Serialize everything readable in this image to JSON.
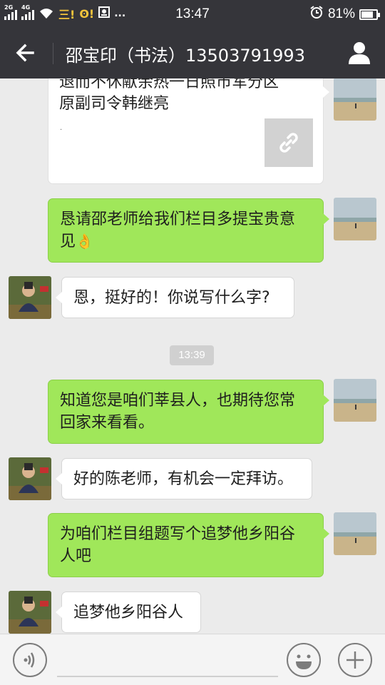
{
  "status_bar": {
    "left": {
      "sim1_label": "2G",
      "sim2_label": "4G",
      "notif_icons": [
        "三!",
        "ʘ!",
        "image-icon",
        "..."
      ]
    },
    "time": "13:47",
    "alarm_icon": "alarm-clock-icon",
    "battery_text": "81%",
    "battery_level": 0.81
  },
  "header": {
    "back_icon": "arrow-left-icon",
    "title": "邵宝印（书法）13503791993",
    "profile_icon": "person-icon"
  },
  "messages": [
    {
      "type": "link_card",
      "from": "me",
      "title_lines": [
        "退而不休献余热一日照市军分区",
        "原副司令韩继亮"
      ],
      "description": "·",
      "thumb_icon": "link-icon"
    },
    {
      "type": "text",
      "from": "me",
      "lines": [
        "恳请邵老师给我们栏目多提宝贵意",
        "见"
      ],
      "emoji": "👌"
    },
    {
      "type": "text",
      "from": "other",
      "text": "恩，挺好的！你说写什么字?"
    },
    {
      "type": "time",
      "text": "13:39"
    },
    {
      "type": "text",
      "from": "me",
      "lines": [
        "知道您是咱们莘县人，也期待您常",
        "回家来看看。"
      ]
    },
    {
      "type": "text",
      "from": "other",
      "text": "好的陈老师，有机会一定拜访。"
    },
    {
      "type": "text",
      "from": "me",
      "lines": [
        "为咱们栏目组题写个追梦他乡阳谷",
        "人吧"
      ]
    },
    {
      "type": "text",
      "from": "other",
      "text": "追梦他乡阳谷人"
    }
  ],
  "input_bar": {
    "voice_icon": "voice-icon",
    "text_value": "",
    "emoji_icon": "smiley-icon",
    "plus_icon": "plus-icon"
  },
  "colors": {
    "header_bg": "#35353a",
    "chat_bg": "#ebebeb",
    "outgoing_bubble": "#a0e75a",
    "incoming_bubble": "#ffffff"
  }
}
